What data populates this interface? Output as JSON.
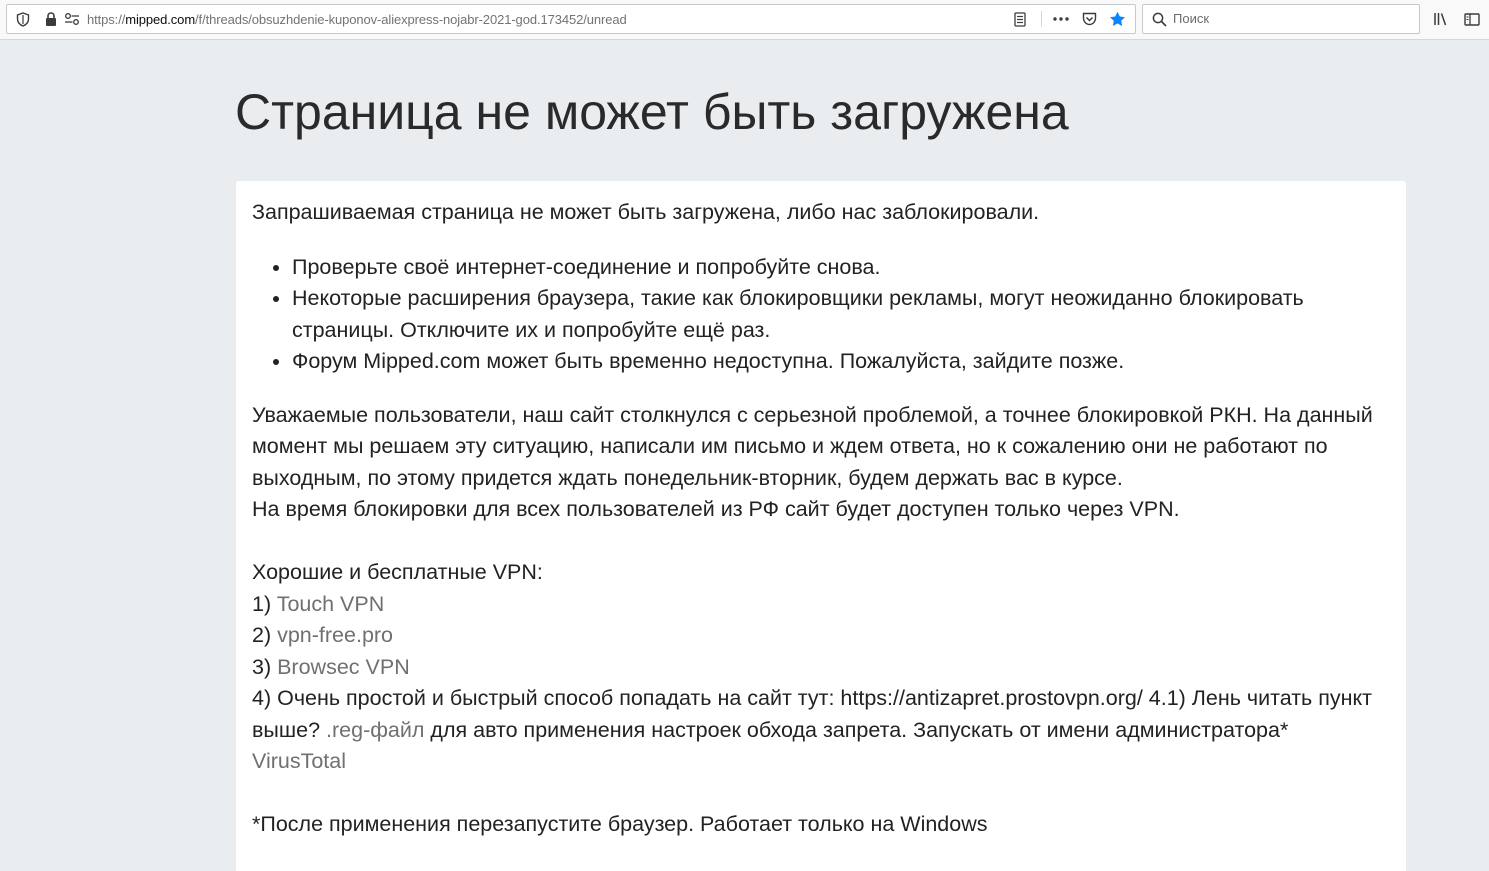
{
  "browser": {
    "url_prefix": "https://",
    "url_domain": "mipped.com",
    "url_path": "/f/threads/obsuzhdenie-kuponov-aliexpress-nojabr-2021-god.173452/unread",
    "search_placeholder": "Поиск",
    "icons": [
      "shield-icon",
      "lock-icon",
      "permissions-icon",
      "reader-view-icon",
      "more-actions-icon",
      "pocket-icon",
      "bookmark-star-icon",
      "search-icon",
      "library-icon",
      "sidebar-icon"
    ],
    "accent_color": "#0a84ff"
  },
  "page": {
    "title": "Страница не может быть загружена",
    "intro": "Запрашиваемая страница не может быть загружена, либо нас заблокировали.",
    "bullets": [
      "Проверьте своё интернет-соединение и попробуйте снова.",
      "Некоторые расширения браузера, такие как блокировщики рекламы, могут неожиданно блокировать страницы. Отключите их и попробуйте ещё раз.",
      "Форум Mipped.com может быть временно недоступна. Пожалуйста, зайдите позже."
    ],
    "notice": "Уважаемые пользователи, наш сайт столкнулся с серьезной проблемой, а точнее блокировкой РКН. На данный момент мы решаем эту ситуацию, написали им письмо и ждем ответа, но к сожалению они не работают по выходным, по этому придется ждать понедельник-вторник, будем держать вас в курсе.",
    "notice2": "На время блокировки для всех пользователей из РФ сайт будет доступен только через VPN.",
    "vpn_heading": "Хорошие и бесплатные VPN:",
    "vpn_items": [
      {
        "num": "1) ",
        "link": "Touch VPN"
      },
      {
        "num": "2) ",
        "link": "vpn-free.pro"
      },
      {
        "num": "3) ",
        "link": "Browsec VPN"
      }
    ],
    "item4_text": "4) Очень простой и быстрый способ попадать на сайт тут: https://antizapret.prostovpn.org/ 4.1) Лень читать пункт выше? ",
    "item4_link": ".reg-файл",
    "item4_text2": " для авто применения настроек обхода запрета. Запускать от имени администратора* ",
    "item4_link2": "VirusTotal",
    "footnote": "*После применения перезапустите браузер. Работает только на Windows"
  }
}
